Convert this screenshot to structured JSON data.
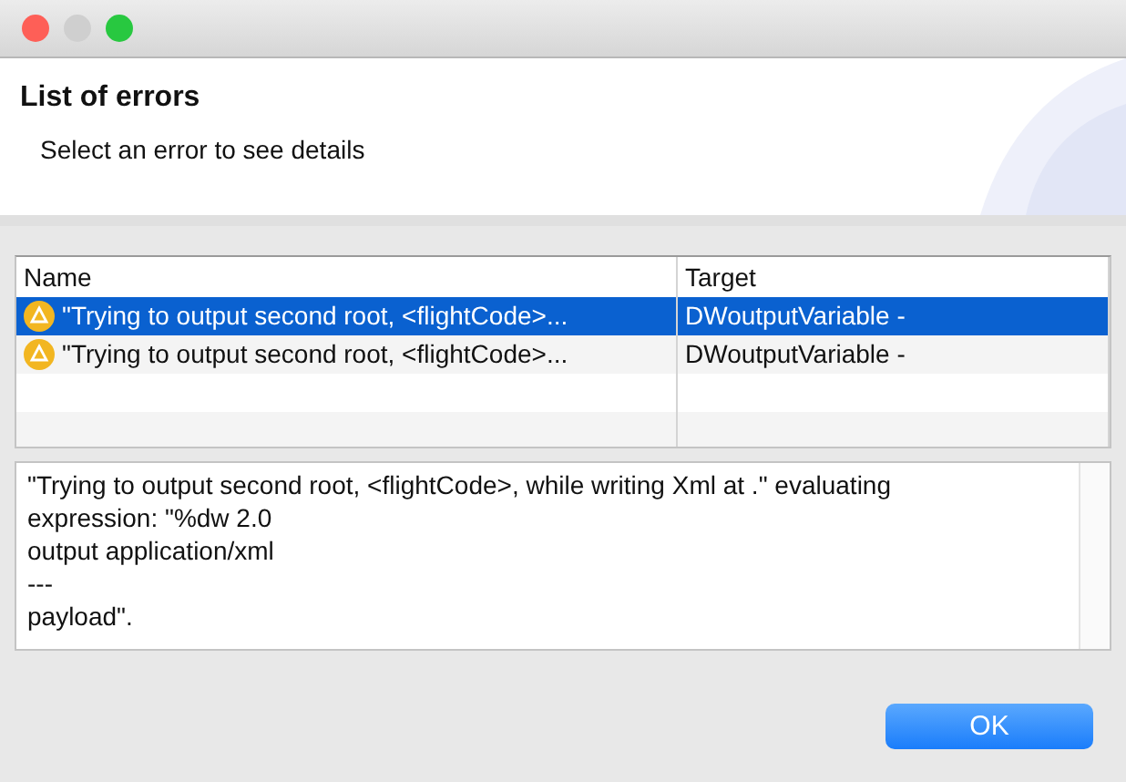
{
  "window": {
    "traffic_lights": [
      {
        "color": "#fe5f57"
      },
      {
        "color": "#cfcfcf"
      },
      {
        "color": "#28c840"
      }
    ]
  },
  "header": {
    "title": "List of errors",
    "subtitle": "Select an error to see details"
  },
  "table": {
    "columns": [
      "Name",
      "Target"
    ],
    "rows": [
      {
        "name": "\"Trying to output second root, <flightCode>...",
        "target": "DWoutputVariable -",
        "selected": true
      },
      {
        "name": "\"Trying to output second root, <flightCode>...",
        "target": "DWoutputVariable -",
        "selected": false
      }
    ]
  },
  "details": "\"Trying to output second root, <flightCode>, while writing Xml at .\" evaluating expression: \"%dw 2.0\noutput application/xml\n---\npayload\".",
  "buttons": [
    {
      "label": "OK",
      "kind": "default"
    }
  ]
}
